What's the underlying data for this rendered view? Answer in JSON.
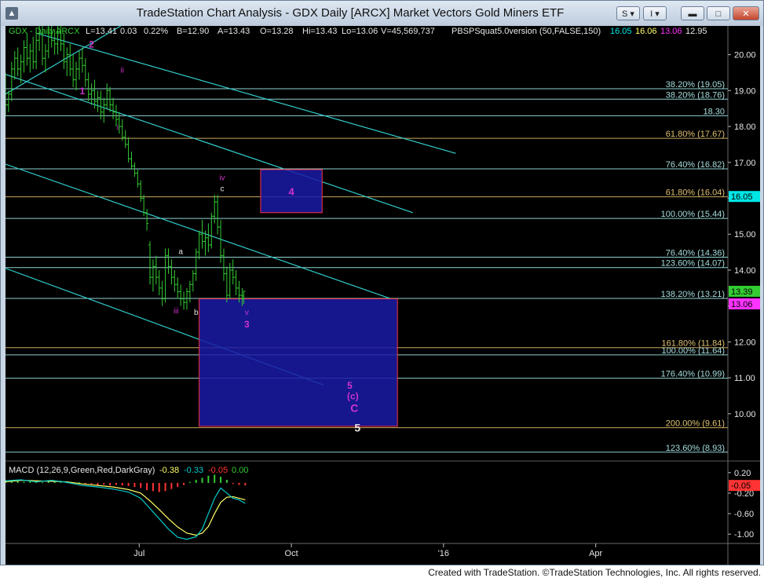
{
  "window": {
    "title": "TradeStation Chart Analysis - GDX Daily [ARCX] Market Vectors Gold Miners ETF",
    "s_button": "S",
    "i_button": "I",
    "credit": "Created with TradeStation. ©TradeStation Technologies, Inc. All rights reserved."
  },
  "header": {
    "symbol": "GDX - Daily",
    "exchange": "ARCX",
    "last": "13.41",
    "change": "0.03",
    "change_pct": "0.22%",
    "bid": "B=12.90",
    "ask": "A=13.43",
    "open": "O=13.28",
    "high": "Hi=13.43",
    "low": "Lo=13.06",
    "volume": "V=45,569,737",
    "study": "PBSPSquat5.0version (50,FALSE,150)",
    "study_values": [
      {
        "text": "16.05",
        "color": "#00e5e5"
      },
      {
        "text": "16.06",
        "color": "#ffff66"
      },
      {
        "text": "13.06",
        "color": "#ff33ff"
      },
      {
        "text": "12.95",
        "color": "#e6e6e6"
      }
    ]
  },
  "colors": {
    "background": "#000000",
    "channel": "#33cccc",
    "fib_line": "#8fd0d0",
    "fib_label": "#a6dede",
    "bar": "#33cc33",
    "wave_label": "#cc33cc",
    "box_fill": "#1a1aa6",
    "box_border": "#ff3344",
    "current_price_bg": "#33cc33",
    "marker_bg": "#ff33ff",
    "level_bg": "#00e5e5",
    "macd_hist_pos": "#33cc33",
    "macd_hist_neg": "#ff3333",
    "macd_line": "#00cccc",
    "signal_line": "#ffff66"
  },
  "chart_data": {
    "type": "candlestick",
    "symbol": "GDX",
    "interval": "Daily",
    "ylim": [
      8.75,
      20.8
    ],
    "y_ticks": [
      10.0,
      11.0,
      12.0,
      13.0,
      14.0,
      15.0,
      16.0,
      17.0,
      18.0,
      19.0,
      20.0
    ],
    "x_ticks": [
      "Jul",
      "Oct",
      "'16",
      "Apr"
    ],
    "x_tick_index": [
      87,
      186,
      285,
      384
    ],
    "x_range": [
      0,
      470
    ],
    "bars": [
      [
        0,
        19.3,
        19.5,
        18.3,
        18.6
      ],
      [
        2,
        18.6,
        19.0,
        18.4,
        18.9
      ],
      [
        4,
        18.9,
        19.8,
        18.7,
        19.6
      ],
      [
        6,
        19.6,
        20.1,
        19.3,
        19.9
      ],
      [
        8,
        19.9,
        20.2,
        19.4,
        19.6
      ],
      [
        10,
        19.6,
        20.0,
        19.2,
        19.8
      ],
      [
        12,
        19.8,
        20.4,
        19.5,
        20.2
      ],
      [
        14,
        20.2,
        20.6,
        19.7,
        19.9
      ],
      [
        16,
        19.9,
        20.3,
        19.5,
        20.1
      ],
      [
        18,
        20.1,
        20.5,
        19.6,
        19.8
      ],
      [
        20,
        19.8,
        20.6,
        19.6,
        20.4
      ],
      [
        22,
        20.4,
        20.9,
        20.1,
        20.6
      ],
      [
        24,
        20.6,
        20.8,
        19.7,
        19.9
      ],
      [
        26,
        19.9,
        20.3,
        19.5,
        20.1
      ],
      [
        28,
        20.1,
        20.8,
        19.9,
        20.6
      ],
      [
        30,
        20.6,
        21.0,
        20.2,
        20.4
      ],
      [
        32,
        20.4,
        20.7,
        20.0,
        20.3
      ],
      [
        34,
        20.3,
        20.8,
        20.0,
        20.6
      ],
      [
        36,
        20.6,
        20.9,
        20.1,
        20.3
      ],
      [
        38,
        20.3,
        20.6,
        19.6,
        19.8
      ],
      [
        40,
        19.8,
        20.2,
        19.4,
        20.0
      ],
      [
        42,
        20.0,
        20.3,
        19.4,
        19.6
      ],
      [
        44,
        19.6,
        20.0,
        19.1,
        19.3
      ],
      [
        46,
        19.3,
        19.8,
        19.0,
        19.6
      ],
      [
        48,
        19.6,
        20.1,
        19.3,
        19.9
      ],
      [
        50,
        19.9,
        20.2,
        19.5,
        19.7
      ],
      [
        52,
        19.7,
        19.9,
        19.1,
        19.3
      ],
      [
        54,
        19.3,
        19.5,
        18.7,
        18.9
      ],
      [
        56,
        18.9,
        19.2,
        18.6,
        19.0
      ],
      [
        58,
        19.0,
        19.3,
        18.5,
        18.7
      ],
      [
        60,
        18.7,
        19.0,
        18.4,
        18.8
      ],
      [
        62,
        18.8,
        19.0,
        18.2,
        18.4
      ],
      [
        64,
        18.4,
        18.8,
        18.1,
        18.6
      ],
      [
        66,
        18.6,
        19.2,
        18.5,
        19.0
      ],
      [
        68,
        19.0,
        19.1,
        18.4,
        18.6
      ],
      [
        70,
        18.6,
        18.8,
        18.2,
        18.4
      ],
      [
        72,
        18.4,
        18.6,
        18.0,
        18.2
      ],
      [
        74,
        18.2,
        18.4,
        17.8,
        18.0
      ],
      [
        76,
        18.0,
        18.2,
        17.6,
        17.7
      ],
      [
        78,
        17.7,
        17.9,
        17.4,
        17.5
      ],
      [
        80,
        17.5,
        17.7,
        17.0,
        17.1
      ],
      [
        82,
        17.1,
        17.3,
        16.8,
        16.9
      ],
      [
        84,
        16.9,
        17.0,
        16.6,
        16.7
      ],
      [
        86,
        16.7,
        16.8,
        16.3,
        16.4
      ],
      [
        88,
        16.4,
        16.5,
        15.9,
        16.0
      ],
      [
        90,
        16.0,
        16.1,
        15.5,
        15.6
      ],
      [
        92,
        15.6,
        15.7,
        15.1,
        15.3
      ],
      [
        94,
        14.7,
        14.8,
        13.6,
        13.8
      ],
      [
        96,
        13.8,
        14.3,
        13.4,
        14.1
      ],
      [
        98,
        14.1,
        14.4,
        13.6,
        13.8
      ],
      [
        100,
        13.8,
        14.0,
        13.3,
        13.5
      ],
      [
        102,
        13.5,
        13.7,
        13.0,
        13.2
      ],
      [
        104,
        13.2,
        14.6,
        13.1,
        14.4
      ],
      [
        106,
        14.4,
        14.6,
        13.9,
        14.1
      ],
      [
        108,
        14.1,
        14.3,
        13.6,
        13.8
      ],
      [
        110,
        13.8,
        14.0,
        13.4,
        13.6
      ],
      [
        112,
        13.6,
        13.8,
        13.2,
        13.4
      ],
      [
        114,
        13.4,
        13.6,
        13.0,
        13.2
      ],
      [
        116,
        13.2,
        13.4,
        12.9,
        13.1
      ],
      [
        118,
        13.1,
        13.5,
        12.9,
        13.4
      ],
      [
        120,
        13.4,
        13.7,
        13.1,
        13.6
      ],
      [
        122,
        13.6,
        14.0,
        13.4,
        13.9
      ],
      [
        124,
        13.9,
        14.6,
        13.7,
        14.5
      ],
      [
        126,
        14.5,
        15.1,
        14.3,
        15.0
      ],
      [
        128,
        15.0,
        15.4,
        14.6,
        14.8
      ],
      [
        130,
        14.8,
        15.1,
        14.4,
        14.9
      ],
      [
        132,
        14.9,
        15.3,
        14.5,
        14.7
      ],
      [
        134,
        14.7,
        15.6,
        14.6,
        15.5
      ],
      [
        136,
        15.5,
        16.1,
        15.3,
        15.9
      ],
      [
        138,
        15.9,
        16.1,
        15.0,
        15.2
      ],
      [
        140,
        15.2,
        15.4,
        14.2,
        14.4
      ],
      [
        142,
        14.4,
        14.6,
        13.7,
        13.9
      ],
      [
        144,
        13.9,
        14.1,
        13.1,
        13.3
      ],
      [
        146,
        13.3,
        14.2,
        13.2,
        14.0
      ],
      [
        148,
        14.0,
        14.3,
        13.6,
        13.8
      ],
      [
        150,
        13.8,
        14.0,
        13.3,
        13.5
      ],
      [
        152,
        13.5,
        13.7,
        13.1,
        13.3
      ],
      [
        154,
        13.3,
        13.5,
        13.0,
        13.2
      ],
      [
        155,
        13.28,
        13.43,
        13.06,
        13.41
      ]
    ],
    "horizontal_levels": [
      {
        "price": 19.05,
        "label": "38.20% (19.05)"
      },
      {
        "price": 18.76,
        "label": "38.20% (18.76)"
      },
      {
        "price": 18.3,
        "label": "18.30"
      },
      {
        "price": 17.67,
        "label": "61.80% (17.67)",
        "style": "gold"
      },
      {
        "price": 16.82,
        "label": "76.40% (16.82)"
      },
      {
        "price": 16.04,
        "label": "61.80% (16.04)",
        "style": "gold"
      },
      {
        "price": 15.44,
        "label": "100.00% (15.44)"
      },
      {
        "price": 14.36,
        "label": "76.40% (14.36)"
      },
      {
        "price": 14.07,
        "label": "123.60% (14.07)"
      },
      {
        "price": 13.21,
        "label": "138.20% (13.21)"
      },
      {
        "price": 11.84,
        "label": "161.80% (11.84)",
        "style": "gold"
      },
      {
        "price": 11.64,
        "label": "100.00% (11.64)"
      },
      {
        "price": 10.99,
        "label": "176.40% (10.99)"
      },
      {
        "price": 9.61,
        "label": "200.00% (9.61)",
        "style": "gold"
      },
      {
        "price": 8.93,
        "label": "123.60% (8.93)"
      }
    ],
    "channel_lines": [
      {
        "from": [
          0,
          18.9
        ],
        "to": [
          75,
          20.8
        ]
      },
      {
        "from": [
          20,
          20.6
        ],
        "to": [
          293,
          17.25
        ]
      },
      {
        "from": [
          0,
          19.45
        ],
        "to": [
          265,
          15.6
        ]
      },
      {
        "from": [
          0,
          16.95
        ],
        "to": [
          251,
          13.2
        ]
      },
      {
        "from": [
          0,
          14.05
        ],
        "to": [
          207,
          10.8
        ]
      }
    ],
    "target_boxes": [
      {
        "x0": 166,
        "x1": 206,
        "y_top": 16.8,
        "y_bottom": 15.6,
        "label": "4"
      },
      {
        "x0": 126,
        "x1": 255,
        "y_top": 13.2,
        "y_bottom": 9.65,
        "label": ""
      }
    ],
    "wave_labels": [
      {
        "text": "1",
        "x": 50,
        "y": 18.9,
        "color": "#cc33cc",
        "size": 12,
        "bold": true
      },
      {
        "text": "2",
        "x": 56,
        "y": 20.2,
        "color": "#cc33cc",
        "size": 12,
        "bold": true
      },
      {
        "text": "ii",
        "x": 76,
        "y": 19.5,
        "color": "#cc33cc",
        "size": 10
      },
      {
        "text": "i",
        "x": 73,
        "y": 17.9,
        "color": "#cc33cc",
        "size": 10
      },
      {
        "text": "iv",
        "x": 141,
        "y": 16.5,
        "color": "#cc33cc",
        "size": 10
      },
      {
        "text": "c",
        "x": 141,
        "y": 16.2,
        "color": "#e6e6e6",
        "size": 10
      },
      {
        "text": "a",
        "x": 114,
        "y": 14.45,
        "color": "#e6e6e6",
        "size": 10
      },
      {
        "text": "iii",
        "x": 111,
        "y": 12.8,
        "color": "#cc33cc",
        "size": 10
      },
      {
        "text": "b",
        "x": 124,
        "y": 12.75,
        "color": "#e6e6e6",
        "size": 10
      },
      {
        "text": "v",
        "x": 157,
        "y": 12.75,
        "color": "#cc33cc",
        "size": 10
      },
      {
        "text": "3",
        "x": 157,
        "y": 12.4,
        "color": "#cc33cc",
        "size": 12,
        "bold": true
      },
      {
        "text": "5",
        "x": 224,
        "y": 10.7,
        "color": "#cc33cc",
        "size": 12,
        "bold": true
      },
      {
        "text": "(c)",
        "x": 226,
        "y": 10.4,
        "color": "#cc33cc",
        "size": 12,
        "bold": true
      },
      {
        "text": "C",
        "x": 227,
        "y": 10.05,
        "color": "#cc33cc",
        "size": 14,
        "bold": true
      },
      {
        "text": "5",
        "x": 229,
        "y": 9.5,
        "color": "#e6e6e6",
        "size": 14,
        "bold": true
      }
    ],
    "price_markers": [
      {
        "price": 16.05,
        "label": "16.05",
        "bg": "#00e5e5",
        "fg": "#000000"
      },
      {
        "price": 13.41,
        "label": "13.39",
        "bg": "#33cc33",
        "fg": "#000000"
      },
      {
        "price": 13.06,
        "label": "13.06",
        "bg": "#ff33ff",
        "fg": "#000000"
      }
    ],
    "macd": {
      "label": "MACD (12,26,9,Green,Red,DarkGray)",
      "macd_value": "-0.38",
      "signal_value": "-0.33",
      "hist_value": "-0.05",
      "zero_value": "0.00",
      "ylim": [
        -1.12,
        0.32
      ],
      "y_ticks": [
        0.2,
        -0.2,
        -0.6,
        -1.0
      ],
      "marker": {
        "price": -0.05,
        "label": "-0.05"
      },
      "macd_line": [
        [
          0,
          0.04
        ],
        [
          10,
          0.06
        ],
        [
          20,
          0.02
        ],
        [
          30,
          0.05
        ],
        [
          40,
          0.01
        ],
        [
          50,
          -0.05
        ],
        [
          60,
          -0.08
        ],
        [
          70,
          -0.12
        ],
        [
          80,
          -0.18
        ],
        [
          88,
          -0.3
        ],
        [
          94,
          -0.5
        ],
        [
          100,
          -0.7
        ],
        [
          106,
          -0.9
        ],
        [
          112,
          -1.06
        ],
        [
          118,
          -1.1
        ],
        [
          124,
          -1.05
        ],
        [
          128,
          -0.9
        ],
        [
          132,
          -0.6
        ],
        [
          136,
          -0.3
        ],
        [
          140,
          -0.1
        ],
        [
          144,
          -0.2
        ],
        [
          148,
          -0.3
        ],
        [
          152,
          -0.33
        ],
        [
          156,
          -0.4
        ]
      ],
      "signal_line": [
        [
          0,
          0.02
        ],
        [
          10,
          0.05
        ],
        [
          20,
          0.04
        ],
        [
          30,
          0.03
        ],
        [
          40,
          0.02
        ],
        [
          50,
          -0.02
        ],
        [
          60,
          -0.05
        ],
        [
          70,
          -0.08
        ],
        [
          80,
          -0.13
        ],
        [
          88,
          -0.2
        ],
        [
          94,
          -0.35
        ],
        [
          100,
          -0.52
        ],
        [
          106,
          -0.7
        ],
        [
          112,
          -0.86
        ],
        [
          118,
          -0.98
        ],
        [
          124,
          -1.02
        ],
        [
          128,
          -0.98
        ],
        [
          132,
          -0.85
        ],
        [
          136,
          -0.6
        ],
        [
          140,
          -0.38
        ],
        [
          144,
          -0.28
        ],
        [
          148,
          -0.27
        ],
        [
          152,
          -0.3
        ],
        [
          156,
          -0.33
        ]
      ],
      "histogram": [
        [
          0,
          0.06
        ],
        [
          4,
          0.04
        ],
        [
          8,
          0.05
        ],
        [
          12,
          0.02
        ],
        [
          16,
          0.04
        ],
        [
          20,
          0.03
        ],
        [
          24,
          0.01
        ],
        [
          28,
          0.03
        ],
        [
          32,
          0.02
        ],
        [
          36,
          0.04
        ],
        [
          40,
          0.01
        ],
        [
          44,
          -0.02
        ],
        [
          48,
          0.01
        ],
        [
          52,
          -0.03
        ],
        [
          56,
          -0.02
        ],
        [
          60,
          -0.04
        ],
        [
          64,
          -0.03
        ],
        [
          68,
          -0.05
        ],
        [
          72,
          -0.04
        ],
        [
          76,
          -0.05
        ],
        [
          80,
          -0.06
        ],
        [
          84,
          -0.08
        ],
        [
          88,
          -0.1
        ],
        [
          92,
          -0.14
        ],
        [
          96,
          -0.16
        ],
        [
          100,
          -0.18
        ],
        [
          104,
          -0.16
        ],
        [
          108,
          -0.12
        ],
        [
          112,
          -0.08
        ],
        [
          116,
          -0.04
        ],
        [
          120,
          0.02
        ],
        [
          124,
          0.06
        ],
        [
          128,
          0.1
        ],
        [
          132,
          0.14
        ],
        [
          136,
          0.16
        ],
        [
          140,
          0.12
        ],
        [
          144,
          0.06
        ],
        [
          148,
          -0.02
        ],
        [
          152,
          -0.04
        ],
        [
          156,
          -0.05
        ]
      ]
    }
  }
}
